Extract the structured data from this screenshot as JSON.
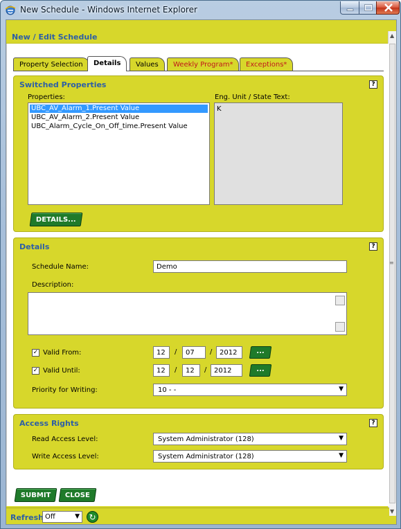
{
  "window": {
    "title": "New Schedule - Windows Internet Explorer"
  },
  "page": {
    "title": "New / Edit Schedule"
  },
  "tabs": [
    {
      "label": "Property Selection",
      "active": false,
      "warning": false
    },
    {
      "label": "Details",
      "active": true,
      "warning": false
    },
    {
      "label": "Values",
      "active": false,
      "warning": false
    },
    {
      "label": "Weekly Program*",
      "active": false,
      "warning": true
    },
    {
      "label": "Exceptions*",
      "active": false,
      "warning": true
    }
  ],
  "switched_properties": {
    "title": "Switched Properties",
    "help": "?",
    "properties_label": "Properties:",
    "unit_label": "Eng. Unit / State Text:",
    "items": [
      {
        "label": "UBC_AV_Alarm_1.Present Value",
        "selected": true
      },
      {
        "label": "UBC_AV_Alarm_2.Present Value",
        "selected": false
      },
      {
        "label": "UBC_Alarm_Cycle_On_Off_time.Present Value",
        "selected": false
      }
    ],
    "unit_value": "K",
    "details_button": "DETAILS..."
  },
  "details": {
    "title": "Details",
    "help": "?",
    "schedule_name_label": "Schedule Name:",
    "schedule_name_value": "Demo",
    "description_label": "Description:",
    "description_value": "",
    "valid_from_label": "Valid From:",
    "valid_from_checked": true,
    "valid_from": {
      "day": "12",
      "month": "07",
      "year": "2012"
    },
    "valid_until_label": "Valid Until:",
    "valid_until_checked": true,
    "valid_until": {
      "day": "12",
      "month": "12",
      "year": "2012"
    },
    "date_separator": "/",
    "date_picker_label": "...",
    "priority_label": "Priority for Writing:",
    "priority_value": "10 - -"
  },
  "access_rights": {
    "title": "Access Rights",
    "help": "?",
    "read_label": "Read Access Level:",
    "read_value": "System Administrator (128)",
    "write_label": "Write Access Level:",
    "write_value": "System Administrator (128)"
  },
  "actions": {
    "submit": "SUBMIT",
    "close": "CLOSE"
  },
  "footer": {
    "refresh_label": "Refresh:",
    "refresh_value": "Off"
  },
  "icons": {
    "window_icon": "internet-explorer-icon",
    "dropdown": "chevron-down-icon",
    "refresh": "refresh-icon",
    "check": "checkmark-icon"
  },
  "colors": {
    "panel": "#d7d72b",
    "title_blue": "#2d5fa6",
    "button_green": "#1f7a2a",
    "warning_red": "#c0161a",
    "selection": "#3399ff"
  }
}
